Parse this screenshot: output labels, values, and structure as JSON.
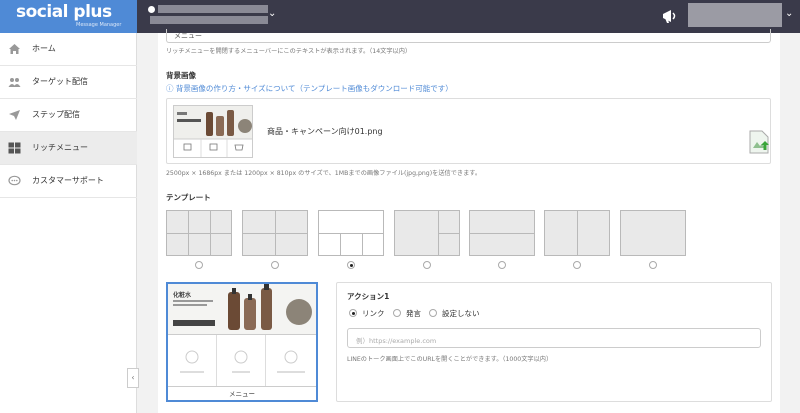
{
  "brand": {
    "name": "social plus",
    "tagline": "Message Manager"
  },
  "sidebar": {
    "items": [
      {
        "label": "ホーム",
        "icon": "home-icon"
      },
      {
        "label": "ターゲット配信",
        "icon": "users-icon"
      },
      {
        "label": "ステップ配信",
        "icon": "send-icon"
      },
      {
        "label": "リッチメニュー",
        "icon": "grid-icon",
        "active": true
      },
      {
        "label": "カスタマーサポート",
        "icon": "chat-icon"
      }
    ],
    "collapse_label": "‹"
  },
  "form": {
    "menu_text_value": "メニュー",
    "menu_text_hint": "リッチメニューを開閉するメニューバーにこのテキストが表示されます。（14文字以内）",
    "background": {
      "label": "背景画像",
      "help_link": "背景画像の作り方・サイズについて（テンプレート画像もダウンロード可能です）",
      "file_name": "商品・キャンペーン向け01.png",
      "size_hint": "2500px × 1686px または 1200px × 810px のサイズで、1MBまでの画像ファイル(jpg,png)を送信できます。"
    },
    "template": {
      "label": "テンプレート",
      "selected_index": 2,
      "count": 7
    },
    "preview": {
      "banner_title": "化粧水",
      "menu_label": "メニュー"
    },
    "action": {
      "title": "アクション1",
      "options": [
        "リンク",
        "発言",
        "設定しない"
      ],
      "selected": 0,
      "url_placeholder": "例）https://example.com",
      "url_hint": "LINEのトーク画面上でこのURLを開くことができます。（1000文字以内）"
    }
  },
  "colors": {
    "accent": "#4f8ad6",
    "topbar": "#3a3a4a"
  }
}
